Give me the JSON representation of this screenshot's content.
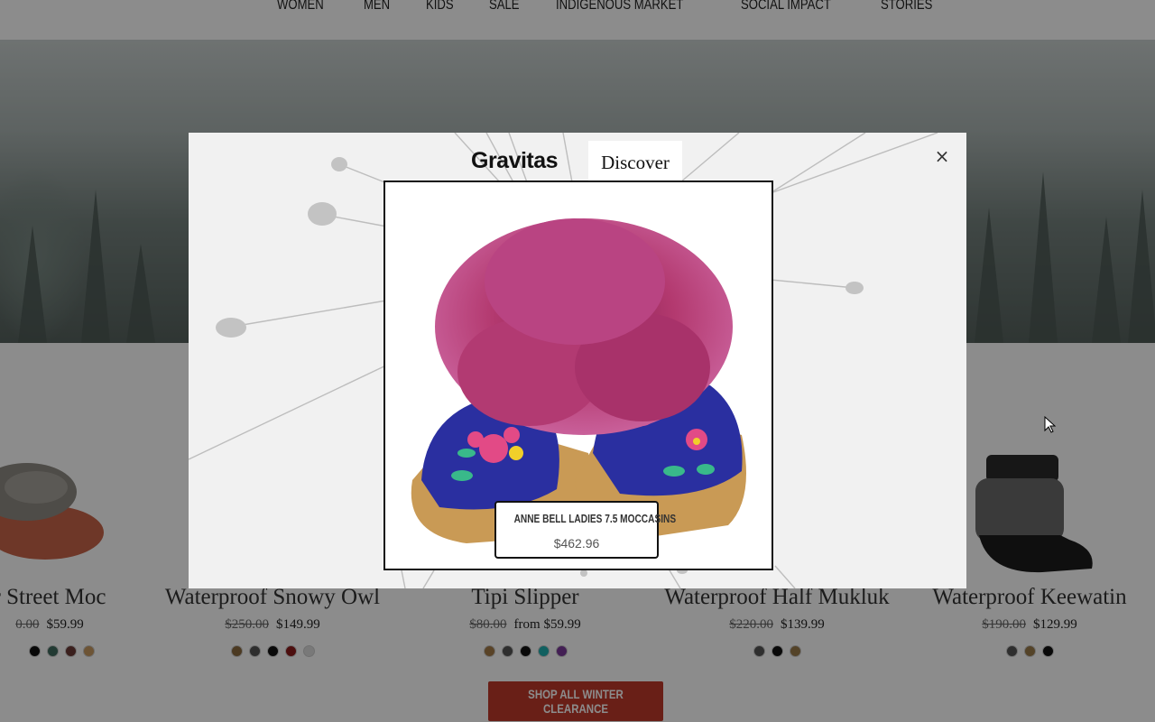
{
  "nav": {
    "items": [
      "WOMEN",
      "MEN",
      "KIDS",
      "SALE",
      "INDIGENOUS MARKET",
      "SOCIAL IMPACT",
      "STORIES"
    ]
  },
  "products": [
    {
      "name": "r Street Moc",
      "old_price": "0.00",
      "price": "$59.99",
      "swatches": [
        "#222222",
        "#111111",
        "#3f6b5d",
        "#6b3a35",
        "#c79a62"
      ]
    },
    {
      "name": "Waterproof Snowy Owl",
      "old_price": "$250.00",
      "price": "$149.99",
      "swatches": [
        "#8a6a3f",
        "#555555",
        "#111111",
        "#8b1a1a",
        "#dddddd"
      ]
    },
    {
      "name": "Tipi Slipper",
      "old_price": "$80.00",
      "price": "from $59.99",
      "swatches": [
        "#a27a48",
        "#555555",
        "#111111",
        "#1fb0b0",
        "#7a3a9a"
      ]
    },
    {
      "name": "Waterproof Half Mukluk",
      "old_price": "$220.00",
      "price": "$139.99",
      "swatches": [
        "#555555",
        "#111111",
        "#9a7a4a"
      ]
    },
    {
      "name": "Waterproof Keewatin",
      "old_price": "$190.00",
      "price": "$129.99",
      "swatches": [
        "#555555",
        "#9a7a4a",
        "#111111"
      ]
    }
  ],
  "shop_button": "SHOP ALL WINTER CLEARANCE",
  "modal": {
    "brand": "Gravitas",
    "tab": "Discover",
    "close_icon": "×",
    "product_title": "ANNE BELL LADIES 7.5 MOCCASINS",
    "product_price": "$462.96"
  },
  "colors": {
    "accent": "#c0392b",
    "modal_bg": "#f1f1f1",
    "fur": "#b0386e",
    "beadwork_bg": "#2a2fa0",
    "suede": "#c99a55"
  },
  "icons": {
    "close": "close-icon",
    "cursor": "mouse-pointer-icon"
  }
}
